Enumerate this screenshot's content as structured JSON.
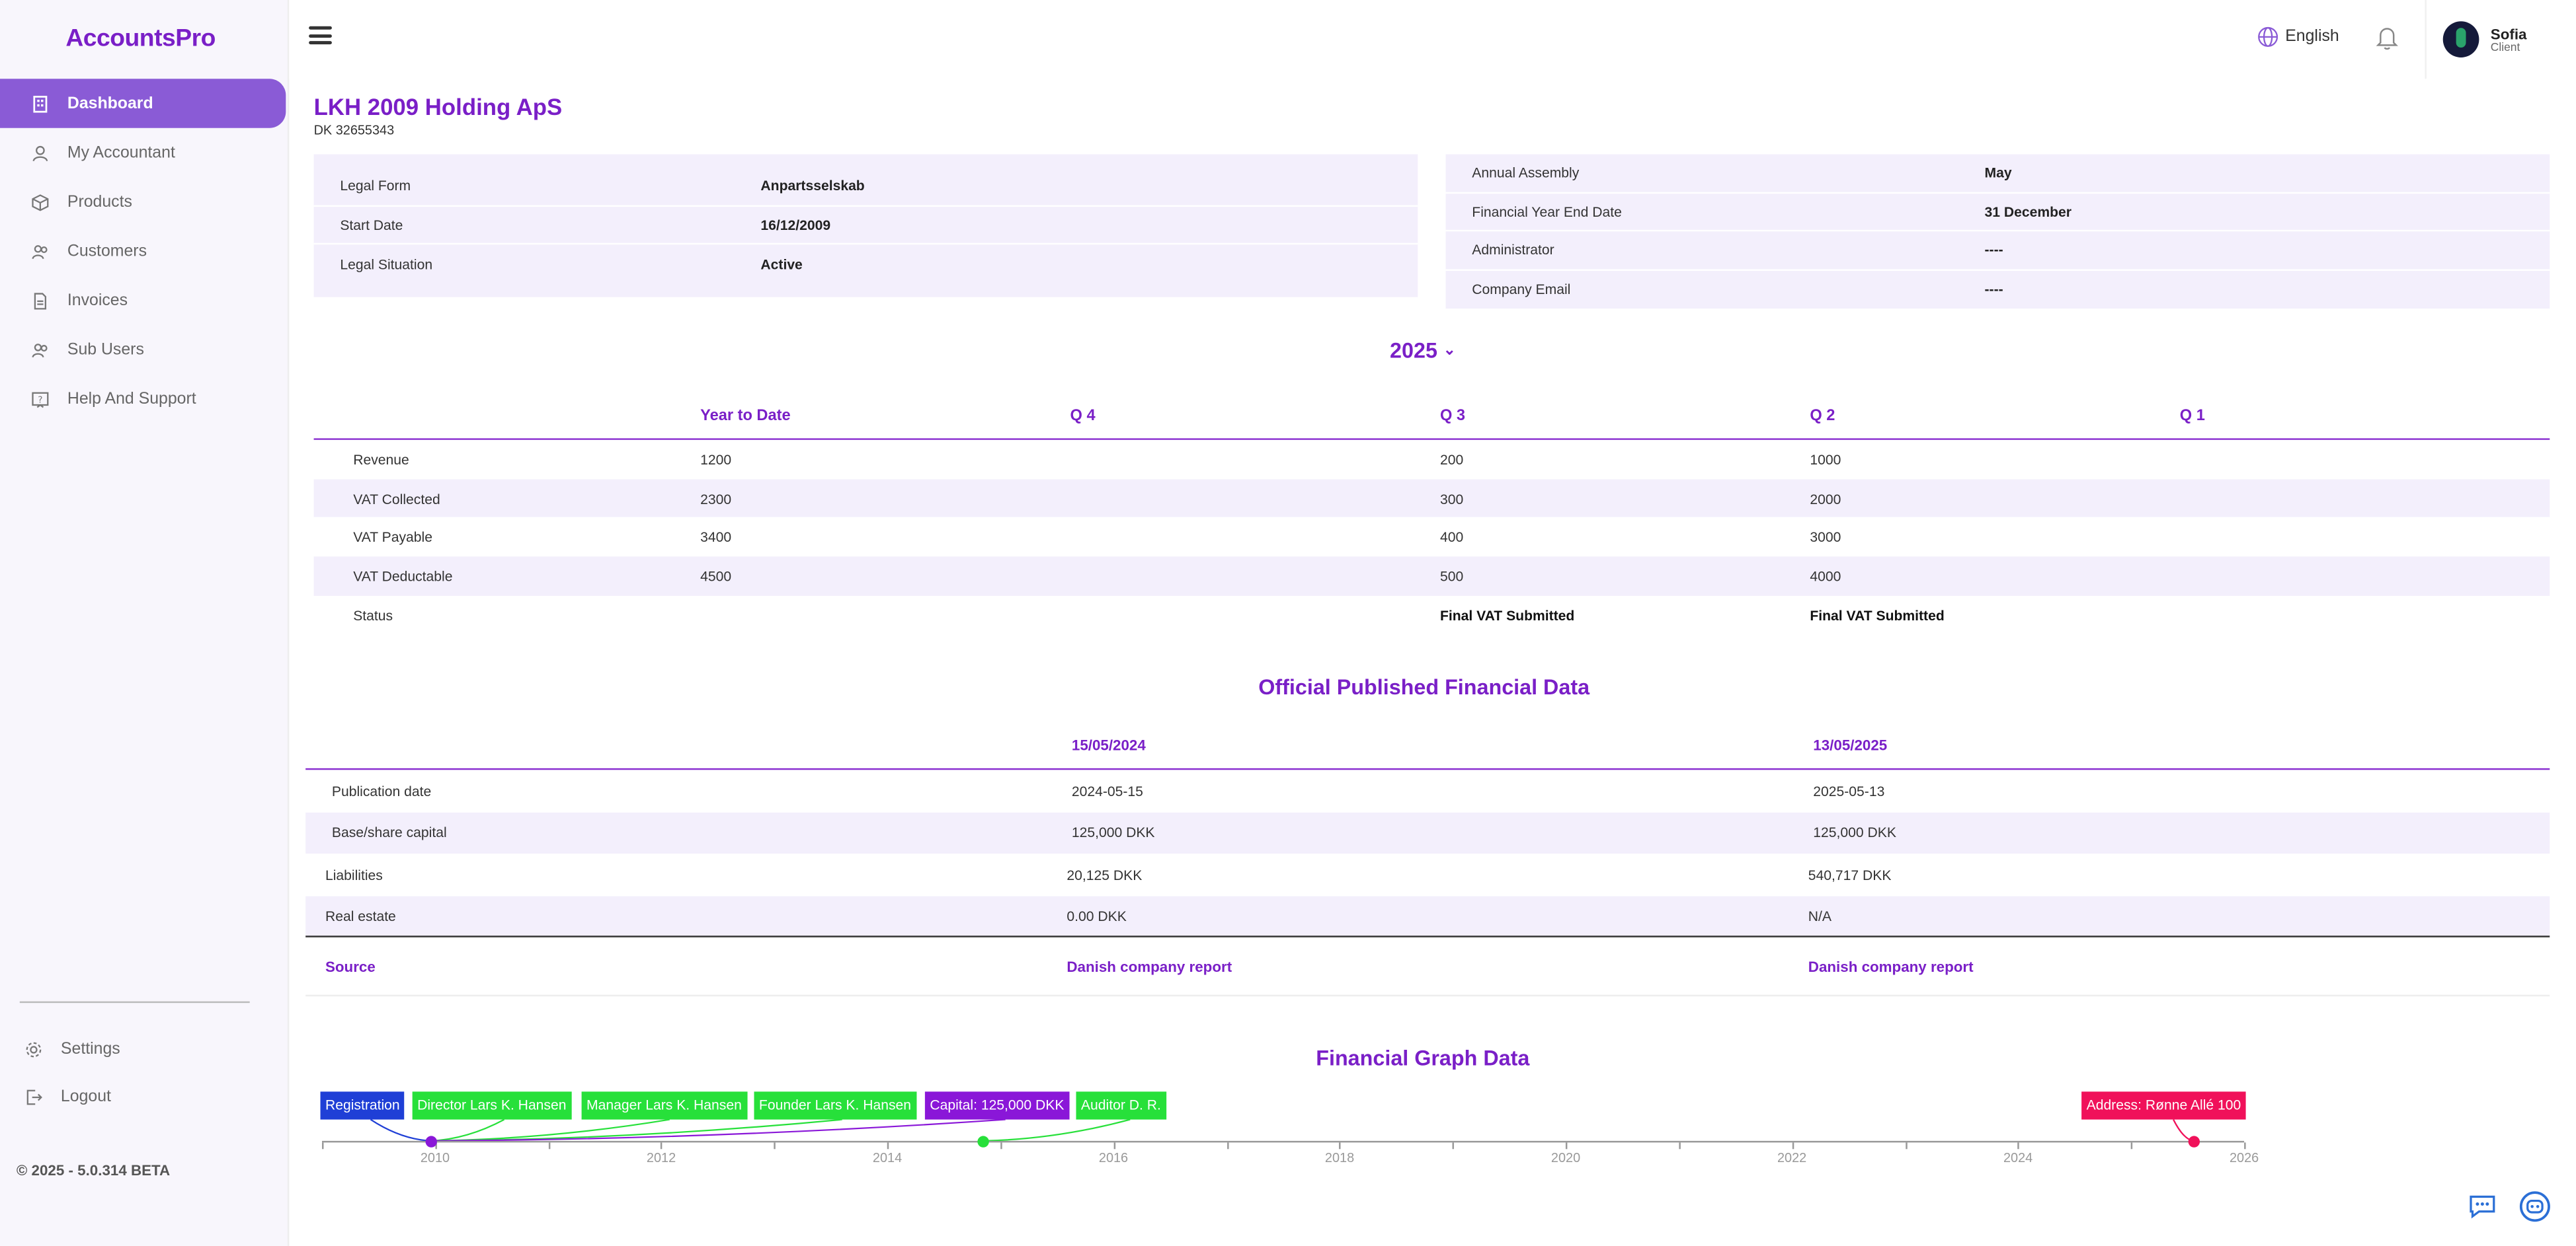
{
  "app": {
    "logo": "AccountsPro",
    "version": "© 2025 - 5.0.314 BETA"
  },
  "sidebar": {
    "items": [
      {
        "label": "Dashboard",
        "icon": "building-icon",
        "active": true
      },
      {
        "label": "My Accountant",
        "icon": "user-icon"
      },
      {
        "label": "Products",
        "icon": "box-icon"
      },
      {
        "label": "Customers",
        "icon": "users-icon"
      },
      {
        "label": "Invoices",
        "icon": "document-icon"
      },
      {
        "label": "Sub Users",
        "icon": "users-icon"
      },
      {
        "label": "Help And Support",
        "icon": "help-icon"
      }
    ],
    "bottom": [
      {
        "label": "Settings",
        "icon": "gear-icon"
      },
      {
        "label": "Logout",
        "icon": "logout-icon"
      }
    ]
  },
  "header": {
    "language": "English",
    "user_name": "Sofia",
    "user_role": "Client"
  },
  "company": {
    "name": "LKH 2009 Holding ApS",
    "cvr": "DK 32655343",
    "left_info": [
      {
        "label": "Legal Form",
        "value": "Anpartsselskab"
      },
      {
        "label": "Start Date",
        "value": "16/12/2009"
      },
      {
        "label": "Legal Situation",
        "value": "Active"
      }
    ],
    "right_info": [
      {
        "label": "Annual Assembly",
        "value": "May"
      },
      {
        "label": "Financial Year End Date",
        "value": "31 December"
      },
      {
        "label": "Administrator",
        "value": "----"
      },
      {
        "label": "Company Email",
        "value": "----"
      }
    ]
  },
  "quarterly": {
    "year": "2025",
    "headers": [
      "",
      "Year to Date",
      "Q 4",
      "Q 3",
      "Q 2",
      "Q 1"
    ],
    "rows": [
      {
        "label": "Revenue",
        "ytd": "1200",
        "q4": "",
        "q3": "200",
        "q2": "1000",
        "q1": ""
      },
      {
        "label": "VAT Collected",
        "ytd": "2300",
        "q4": "",
        "q3": "300",
        "q2": "2000",
        "q1": ""
      },
      {
        "label": "VAT Payable",
        "ytd": "3400",
        "q4": "",
        "q3": "400",
        "q2": "3000",
        "q1": ""
      },
      {
        "label": "VAT Deductable",
        "ytd": "4500",
        "q4": "",
        "q3": "500",
        "q2": "4000",
        "q1": ""
      },
      {
        "label": "Status",
        "ytd": "",
        "q4": "",
        "q3": "Final VAT Submitted",
        "q2": "Final VAT Submitted",
        "q1": ""
      }
    ]
  },
  "published": {
    "title": "Official Published Financial Data",
    "dates": [
      "15/05/2024",
      "13/05/2025"
    ],
    "rows": [
      {
        "label": "Publication date",
        "a": "2024-05-15",
        "b": "2025-05-13"
      },
      {
        "label": "Base/share capital",
        "a": "125,000 DKK",
        "b": "125,000 DKK"
      },
      {
        "label": "Liabilities",
        "a": "20,125 DKK",
        "b": "540,717 DKK"
      },
      {
        "label": "Real estate",
        "a": "0.00 DKK",
        "b": "N/A"
      }
    ],
    "source_label": "Source",
    "source_a": "Danish company report",
    "source_b": "Danish company report"
  },
  "graph": {
    "title": "Financial Graph Data",
    "axis_years": [
      "2010",
      "2012",
      "2014",
      "2016",
      "2018",
      "2020",
      "2022",
      "2024",
      "2026"
    ],
    "events": [
      {
        "label": "Registration",
        "color": "#1f3fd6",
        "year": 2009.96
      },
      {
        "label": "Director Lars K. Hansen",
        "color": "#27e03a",
        "year": 2009.96
      },
      {
        "label": "Manager Lars K. Hansen",
        "color": "#27e03a",
        "year": 2009.96
      },
      {
        "label": "Founder Lars K. Hansen",
        "color": "#27e03a",
        "year": 2009.96
      },
      {
        "label": "Capital: 125,000 DKK",
        "color": "#8a17d8",
        "year": 2009.96
      },
      {
        "label": "Auditor D. R.",
        "color": "#27e03a",
        "year": 2014.85
      },
      {
        "label": "Address: Rønne Allé 100",
        "color": "#f0115a",
        "year": 2025.55
      }
    ]
  }
}
